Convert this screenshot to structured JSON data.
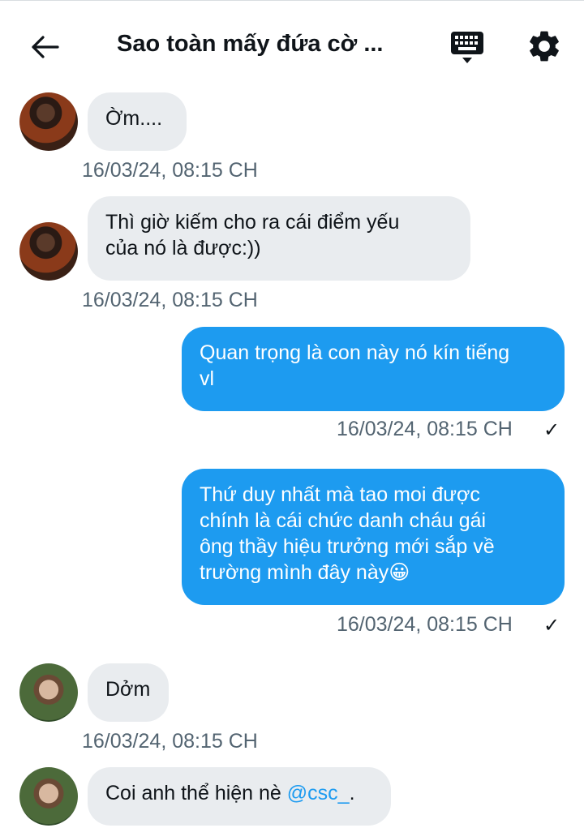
{
  "header": {
    "title": "Sao toàn mấy đứa cờ ...",
    "back_icon": "arrow-left-icon",
    "keyboard_icon": "keyboard-icon",
    "settings_icon": "gear-icon"
  },
  "messages": [
    {
      "direction": "in",
      "text": "Ờm....",
      "timestamp": "16/03/24, 08:15 CH"
    },
    {
      "direction": "in",
      "text_lines": [
        "Thì giờ kiếm cho ra cái điểm yếu",
        "của nó là được:))"
      ],
      "timestamp": "16/03/24, 08:15 CH"
    },
    {
      "direction": "out",
      "text_lines": [
        "Quan trọng là con này nó kín tiếng",
        "vl"
      ],
      "timestamp": "16/03/24, 08:15 CH",
      "status": "✓"
    },
    {
      "direction": "out",
      "text_lines": [
        "Thứ duy nhất mà tao moi được",
        "chính là cái chức danh cháu gái",
        "ông thầy hiệu trưởng mới sắp về",
        "trường mình đây này😀"
      ],
      "timestamp": "16/03/24, 08:15 CH",
      "status": "✓"
    },
    {
      "direction": "in",
      "text": "Dởm",
      "timestamp": "16/03/24, 08:15 CH"
    },
    {
      "direction": "in",
      "text_prefix": "Coi anh thể hiện nè ",
      "mention": "@csc_",
      "text_suffix": "."
    }
  ],
  "colors": {
    "outgoing_bubble": "#1d9bf0",
    "incoming_bubble": "#e9ecef",
    "timestamp": "#536471",
    "mention": "#1d9bf0"
  }
}
